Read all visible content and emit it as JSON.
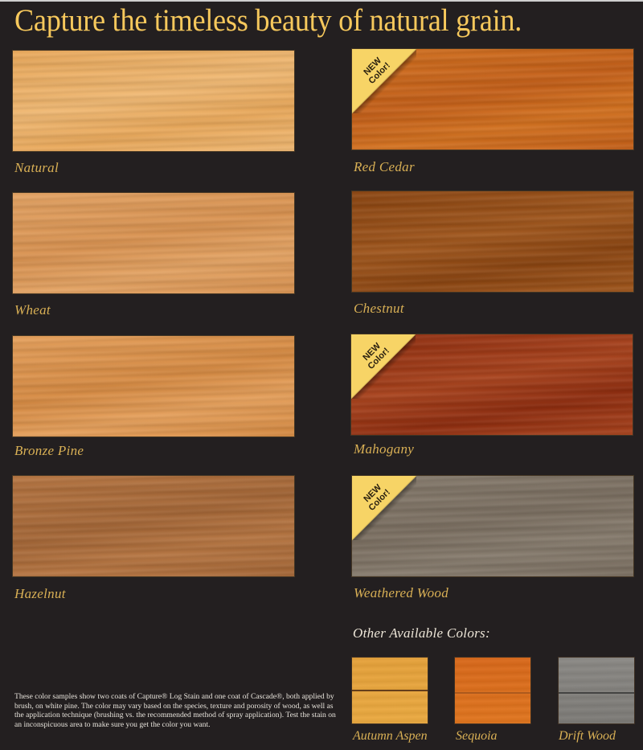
{
  "headline": "Capture the timeless beauty of natural grain.",
  "badge": {
    "line1": "NEW",
    "line2": "Color!",
    "color": "#f7d466"
  },
  "swatches": [
    {
      "name": "Natural",
      "color": "#e9a85a",
      "color2": "#f0b872",
      "is_new": false
    },
    {
      "name": "Red Cedar",
      "color": "#d2701e",
      "color2": "#c45f18",
      "is_new": true
    },
    {
      "name": "Wheat",
      "color": "#e3a262",
      "color2": "#d99250",
      "is_new": false
    },
    {
      "name": "Chestnut",
      "color": "#8a4410",
      "color2": "#a0561c",
      "is_new": false
    },
    {
      "name": "Bronze Pine",
      "color": "#e59f5a",
      "color2": "#d68a42",
      "is_new": false
    },
    {
      "name": "Mahogany",
      "color": "#8e2c0e",
      "color2": "#a8421c",
      "is_new": true
    },
    {
      "name": "Hazelnut",
      "color": "#b57440",
      "color2": "#a46636",
      "is_new": false
    },
    {
      "name": "Weathered Wood",
      "color": "#857a6c",
      "color2": "#7a6e60",
      "is_new": true
    }
  ],
  "other_colors": {
    "title": "Other Available Colors:",
    "items": [
      {
        "name": "Autumn Aspen",
        "color": "#e5a13a",
        "color2": "#eaa940"
      },
      {
        "name": "Sequoia",
        "color": "#d8681a",
        "color2": "#e0751e"
      },
      {
        "name": "Drift Wood",
        "color": "#8a8884",
        "color2": "#7c7a76"
      }
    ]
  },
  "disclaimer": "These color samples show two coats of Capture® Log Stain and one coat of Cascade®, both applied by brush, on white pine. The color may vary based on the species, texture and porosity of wood, as well as the application technique (brushing vs. the recommended method of spray application). Test the stain on an inconspicuous area to make sure you get the color you want.",
  "colors": {
    "background": "#231f20",
    "headline": "#f6c85c",
    "label": "#d9b055"
  }
}
